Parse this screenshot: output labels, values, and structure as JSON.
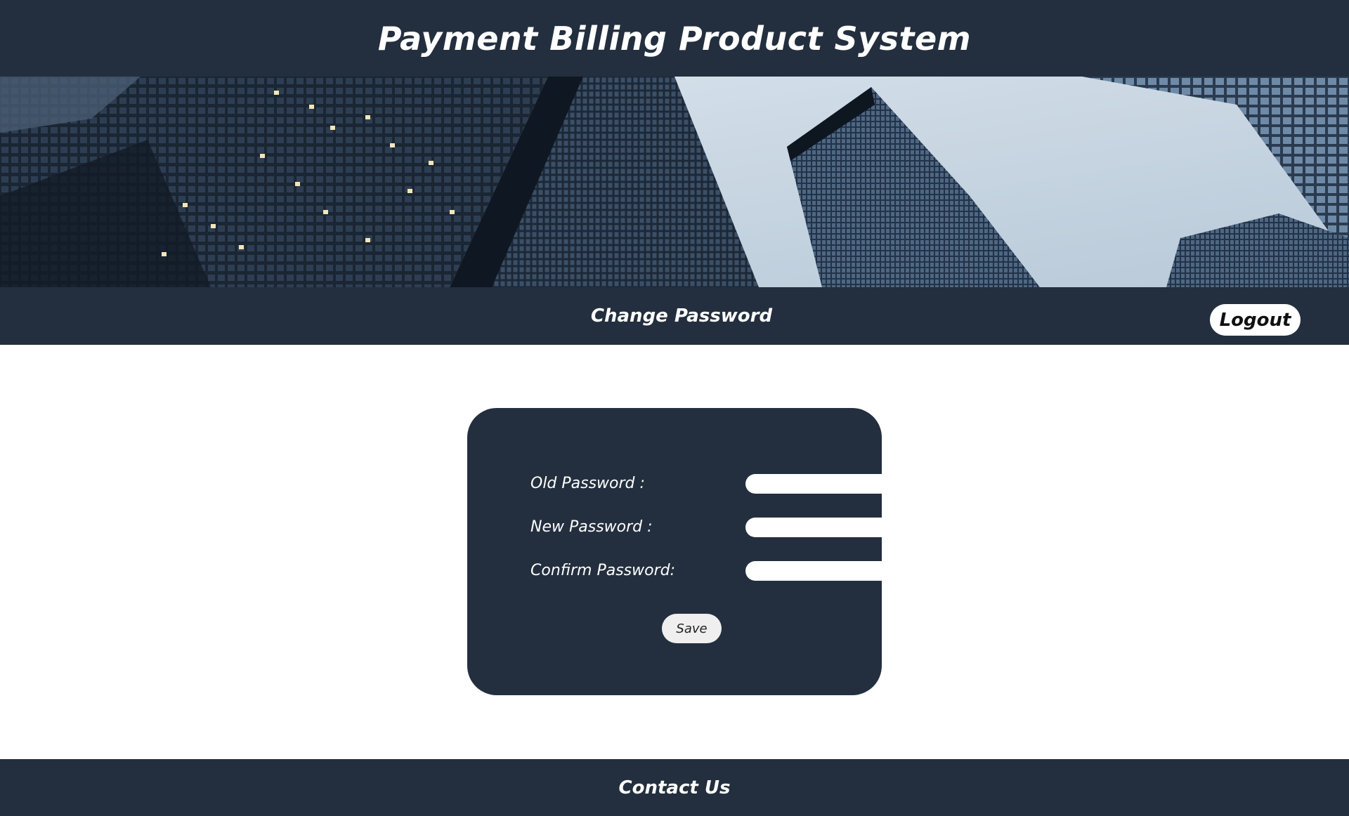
{
  "header": {
    "title": "Payment Billing Product System"
  },
  "banner": {
    "alt": "city skyscrapers banner"
  },
  "navbar": {
    "title": "Change Password",
    "logout_label": "Logout"
  },
  "form": {
    "old_password_label": "Old Password :",
    "new_password_label": "New Password :",
    "confirm_password_label": "Confirm Password:",
    "old_password_value": "",
    "new_password_value": "",
    "confirm_password_value": "",
    "save_label": "Save"
  },
  "footer": {
    "contact_label": "Contact Us"
  },
  "colors": {
    "dark": "#232f3e",
    "white": "#ffffff",
    "button_light": "#efefef"
  }
}
